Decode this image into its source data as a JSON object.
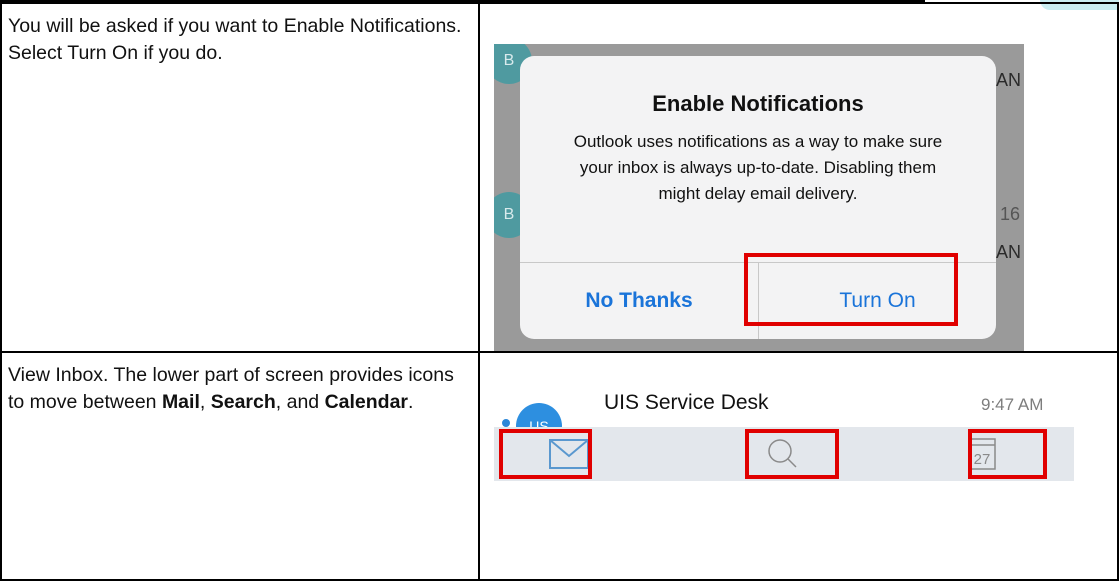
{
  "document": {
    "rows": [
      {
        "instruction": "You will be asked if you want to Enable Notifications. Select Turn On if you do."
      },
      {
        "instruction_parts": [
          {
            "text": "View Inbox.  The lower part of screen provides icons to move between ",
            "bold": false
          },
          {
            "text": "Mail",
            "bold": true
          },
          {
            "text": ", ",
            "bold": false
          },
          {
            "text": "Search",
            "bold": true
          },
          {
            "text": ", and ",
            "bold": false
          },
          {
            "text": "Calendar",
            "bold": true
          },
          {
            "text": ".",
            "bold": false
          }
        ]
      }
    ]
  },
  "alert_screenshot": {
    "background_avatar_letter": "B",
    "background_fragments": [
      "AN",
      "16",
      "AN"
    ],
    "title": "Enable Notifications",
    "message": "Outlook uses notifications as a way to make sure your inbox is always up-to-date. Disabling them might delay email delivery.",
    "buttons": {
      "no_thanks": "No Thanks",
      "turn_on": "Turn On"
    },
    "highlighted": "turn_on"
  },
  "inbox_screenshot": {
    "avatar_initials": "US",
    "sender": "UIS Service Desk",
    "time": "9:47 AM",
    "tabs": [
      {
        "name": "mail",
        "icon": "envelope-icon"
      },
      {
        "name": "search",
        "icon": "search-icon"
      },
      {
        "name": "calendar",
        "icon": "calendar-icon",
        "day": "27"
      }
    ]
  },
  "colors": {
    "highlight": "#e00000",
    "ios_blue": "#1a74d9",
    "avatar_teal": "#4f9aa0",
    "tabbar": "#e3e7ec",
    "icon_stroke": "#5a98cf",
    "icon_grey": "#8a8a8a"
  }
}
